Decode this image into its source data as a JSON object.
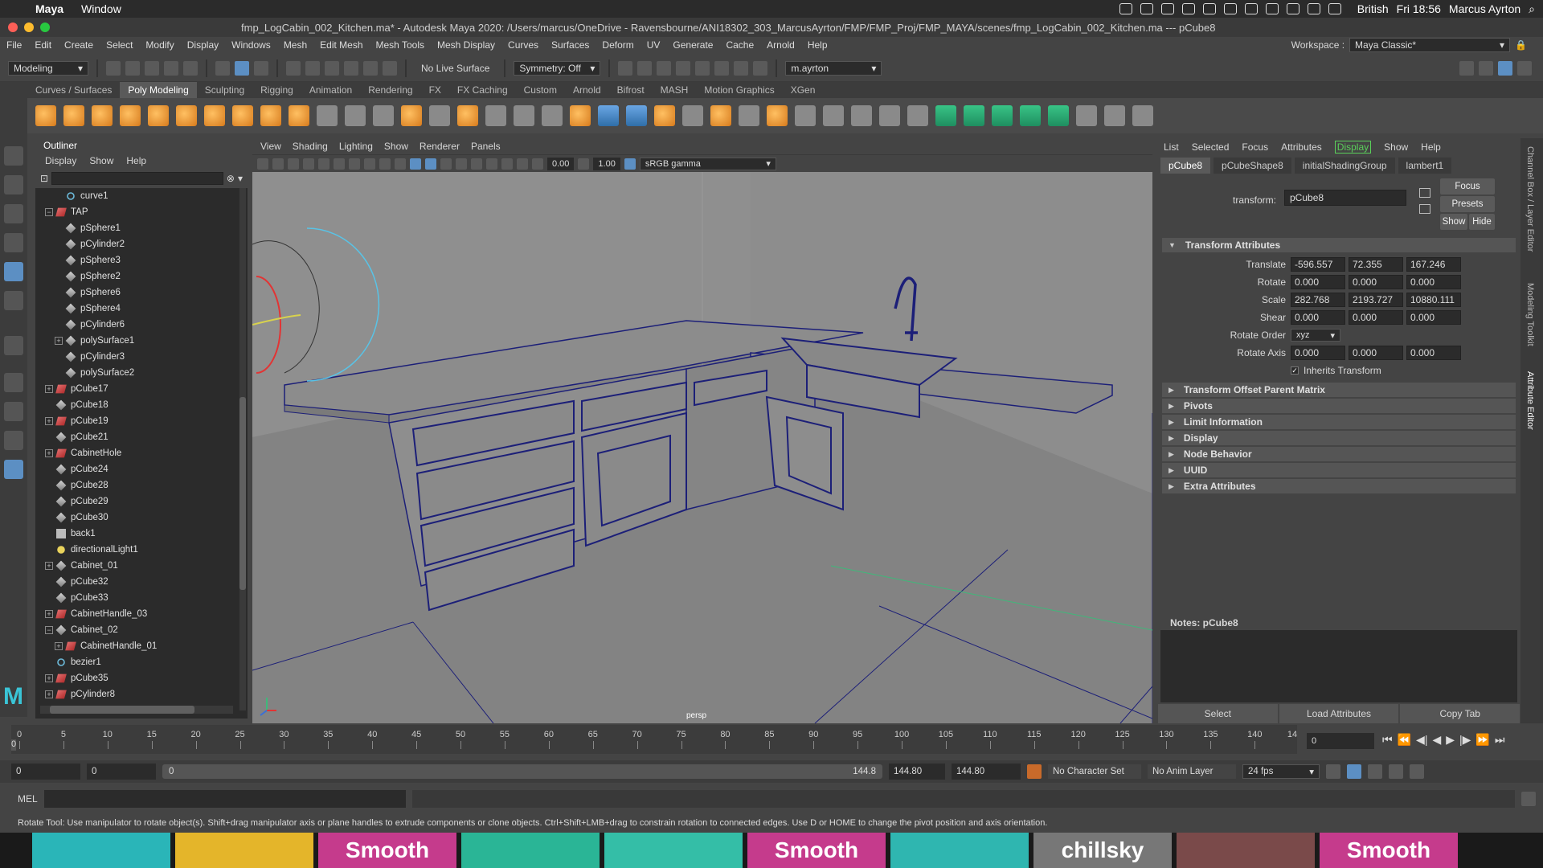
{
  "macbar": {
    "app": "Maya",
    "menu": [
      "Window"
    ],
    "keyboard": "British",
    "clock": "Fri 18:56",
    "user": "Marcus Ayrton"
  },
  "titlebar": {
    "title": "fmp_LogCabin_002_Kitchen.ma* - Autodesk Maya 2020: /Users/marcus/OneDrive - Ravensbourne/ANI18302_303_MarcusAyrton/FMP/FMP_Proj/FMP_MAYA/scenes/fmp_LogCabin_002_Kitchen.ma  ---  pCube8"
  },
  "mainmenu": [
    "File",
    "Edit",
    "Create",
    "Select",
    "Modify",
    "Display",
    "Windows",
    "Mesh",
    "Edit Mesh",
    "Mesh Tools",
    "Mesh Display",
    "Curves",
    "Surfaces",
    "Deform",
    "UV",
    "Generate",
    "Cache",
    "Arnold",
    "Help"
  ],
  "workspace": {
    "label": "Workspace :",
    "value": "Maya Classic*"
  },
  "statusline": {
    "mode": "Modeling",
    "live_surface": "No Live Surface",
    "symmetry": "Symmetry: Off",
    "user": "m.ayrton"
  },
  "shelf": {
    "tabs": [
      "Curves / Surfaces",
      "Poly Modeling",
      "Sculpting",
      "Rigging",
      "Animation",
      "Rendering",
      "FX",
      "FX Caching",
      "Custom",
      "Arnold",
      "Bifrost",
      "MASH",
      "Motion Graphics",
      "XGen"
    ],
    "active": "Poly Modeling"
  },
  "outliner": {
    "title": "Outliner",
    "menu": [
      "Display",
      "Show",
      "Help"
    ],
    "items": [
      {
        "name": "curve1",
        "icon": "curve",
        "indent": 1,
        "exp": ""
      },
      {
        "name": "TAP",
        "icon": "xf",
        "indent": 0,
        "exp": "−"
      },
      {
        "name": "pSphere1",
        "icon": "mesh",
        "indent": 1,
        "exp": ""
      },
      {
        "name": "pCylinder2",
        "icon": "mesh",
        "indent": 1,
        "exp": ""
      },
      {
        "name": "pSphere3",
        "icon": "mesh",
        "indent": 1,
        "exp": ""
      },
      {
        "name": "pSphere2",
        "icon": "mesh",
        "indent": 1,
        "exp": ""
      },
      {
        "name": "pSphere6",
        "icon": "mesh",
        "indent": 1,
        "exp": ""
      },
      {
        "name": "pSphere4",
        "icon": "mesh",
        "indent": 1,
        "exp": ""
      },
      {
        "name": "pCylinder6",
        "icon": "mesh",
        "indent": 1,
        "exp": ""
      },
      {
        "name": "polySurface1",
        "icon": "mesh",
        "indent": 1,
        "exp": "+"
      },
      {
        "name": "pCylinder3",
        "icon": "mesh",
        "indent": 1,
        "exp": ""
      },
      {
        "name": "polySurface2",
        "icon": "mesh",
        "indent": 1,
        "exp": ""
      },
      {
        "name": "pCube17",
        "icon": "xf",
        "indent": 0,
        "exp": "+"
      },
      {
        "name": "pCube18",
        "icon": "mesh",
        "indent": 0,
        "exp": ""
      },
      {
        "name": "pCube19",
        "icon": "xf",
        "indent": 0,
        "exp": "+"
      },
      {
        "name": "pCube21",
        "icon": "mesh",
        "indent": 0,
        "exp": ""
      },
      {
        "name": "CabinetHole",
        "icon": "xf",
        "indent": 0,
        "exp": "+"
      },
      {
        "name": "pCube24",
        "icon": "mesh",
        "indent": 0,
        "exp": ""
      },
      {
        "name": "pCube28",
        "icon": "mesh",
        "indent": 0,
        "exp": ""
      },
      {
        "name": "pCube29",
        "icon": "mesh",
        "indent": 0,
        "exp": ""
      },
      {
        "name": "pCube30",
        "icon": "mesh",
        "indent": 0,
        "exp": ""
      },
      {
        "name": "back1",
        "icon": "cam",
        "indent": 0,
        "exp": ""
      },
      {
        "name": "directionalLight1",
        "icon": "light",
        "indent": 0,
        "exp": ""
      },
      {
        "name": "Cabinet_01",
        "icon": "mesh",
        "indent": 0,
        "exp": "+"
      },
      {
        "name": "pCube32",
        "icon": "mesh",
        "indent": 0,
        "exp": ""
      },
      {
        "name": "pCube33",
        "icon": "mesh",
        "indent": 0,
        "exp": ""
      },
      {
        "name": "CabinetHandle_03",
        "icon": "xf",
        "indent": 0,
        "exp": "+"
      },
      {
        "name": "Cabinet_02",
        "icon": "mesh",
        "indent": 0,
        "exp": "−"
      },
      {
        "name": "CabinetHandle_01",
        "icon": "xf",
        "indent": 1,
        "exp": "+"
      },
      {
        "name": "bezier1",
        "icon": "curve",
        "indent": 0,
        "exp": ""
      },
      {
        "name": "pCube35",
        "icon": "xf",
        "indent": 0,
        "exp": "+"
      },
      {
        "name": "pCylinder8",
        "icon": "xf",
        "indent": 0,
        "exp": "+"
      }
    ]
  },
  "viewport": {
    "menu": [
      "View",
      "Shading",
      "Lighting",
      "Show",
      "Renderer",
      "Panels"
    ],
    "field1": "0.00",
    "field2": "1.00",
    "colorspace": "sRGB gamma",
    "camera": "persp"
  },
  "attribute_editor": {
    "menu": [
      "List",
      "Selected",
      "Focus",
      "Attributes",
      "Display",
      "Show",
      "Help"
    ],
    "menu_active": "Display",
    "tabs": [
      "pCube8",
      "pCubeShape8",
      "initialShadingGroup",
      "lambert1"
    ],
    "active_tab": "pCube8",
    "transform_label": "transform:",
    "transform_value": "pCube8",
    "buttons": {
      "focus": "Focus",
      "presets": "Presets",
      "show": "Show",
      "hide": "Hide"
    },
    "section_transform": "Transform Attributes",
    "translate": {
      "label": "Translate",
      "x": "-596.557",
      "y": "72.355",
      "z": "167.246"
    },
    "rotate": {
      "label": "Rotate",
      "x": "0.000",
      "y": "0.000",
      "z": "0.000"
    },
    "scale": {
      "label": "Scale",
      "x": "282.768",
      "y": "2193.727",
      "z": "10880.111"
    },
    "shear": {
      "label": "Shear",
      "x": "0.000",
      "y": "0.000",
      "z": "0.000"
    },
    "rotate_order": {
      "label": "Rotate Order",
      "value": "xyz"
    },
    "rotate_axis": {
      "label": "Rotate Axis",
      "x": "0.000",
      "y": "0.000",
      "z": "0.000"
    },
    "inherits": "Inherits Transform",
    "sections": [
      "Transform Offset Parent Matrix",
      "Pivots",
      "Limit Information",
      "Display",
      "Node Behavior",
      "UUID",
      "Extra Attributes"
    ],
    "notes_label": "Notes:  pCube8",
    "bottom": [
      "Select",
      "Load Attributes",
      "Copy Tab"
    ],
    "side_tabs": [
      "Channel Box / Layer Editor",
      "Modeling Toolkit",
      "Attribute Editor"
    ]
  },
  "timeslider": {
    "ticks": [
      0,
      5,
      10,
      15,
      20,
      25,
      30,
      35,
      40,
      45,
      50,
      55,
      60,
      65,
      70,
      75,
      80,
      85,
      90,
      95,
      100,
      105,
      110,
      115,
      120,
      125,
      130,
      135,
      140
    ],
    "current": "0",
    "end_field": "0",
    "last_tick": "14"
  },
  "range": {
    "start": "0",
    "start2": "0",
    "bar_left": "0",
    "bar_right": "144.8",
    "end1": "144.80",
    "end2": "144.80",
    "char_set": "No Character Set",
    "anim_layer": "No Anim Layer",
    "fps": "24 fps"
  },
  "cmd": {
    "label": "MEL"
  },
  "help": "Rotate Tool: Use manipulator to rotate object(s). Shift+drag manipulator axis or plane handles to extrude components or clone objects. Ctrl+Shift+LMB+drag to constrain rotation to connected edges. Use D or HOME to change the pivot position and axis orientation.",
  "dock": [
    {
      "label": "",
      "color": "#2ab5b8"
    },
    {
      "label": "",
      "color": "#e4b52a"
    },
    {
      "label": "Smooth",
      "color": "#c53b8c"
    },
    {
      "label": "",
      "color": "#2ab596"
    },
    {
      "label": "",
      "color": "#34bea7"
    },
    {
      "label": "Smooth",
      "color": "#c53b8c"
    },
    {
      "label": "",
      "color": "#2fb6b0"
    },
    {
      "label": "chillsky",
      "color": "#777777"
    },
    {
      "label": "",
      "color": "#7a4a4a"
    },
    {
      "label": "Smooth",
      "color": "#c53b8c"
    }
  ]
}
